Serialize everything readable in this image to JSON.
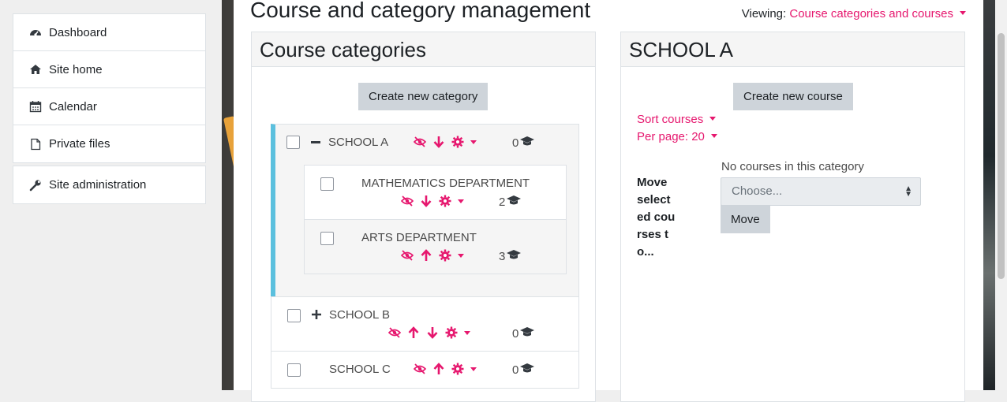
{
  "sidebar": {
    "items": [
      {
        "label": "Dashboard",
        "icon": "dashboard-icon"
      },
      {
        "label": "Site home",
        "icon": "home-icon"
      },
      {
        "label": "Calendar",
        "icon": "calendar-icon"
      },
      {
        "label": "Private files",
        "icon": "file-icon"
      }
    ],
    "admin": {
      "label": "Site administration",
      "icon": "wrench-icon"
    }
  },
  "header": {
    "title": "Course and category management",
    "viewing_label": "Viewing:",
    "viewing_value": "Course categories and courses"
  },
  "categories_panel": {
    "title": "Course categories",
    "create_button": "Create new category",
    "rows": [
      {
        "name": "SCHOOL A",
        "count": "0",
        "expanded": true
      },
      {
        "name": "MATHEMATICS DEPARTMENT",
        "count": "2"
      },
      {
        "name": "ARTS DEPARTMENT",
        "count": "3"
      },
      {
        "name": "SCHOOL B",
        "count": "0"
      },
      {
        "name": "SCHOOL C",
        "count": "0"
      }
    ]
  },
  "courses_panel": {
    "title": "SCHOOL A",
    "create_button": "Create new course",
    "sort_label": "Sort courses",
    "per_page_label": "Per page: 20",
    "move_label": "Move selected courses to...",
    "empty_text": "No courses in this category",
    "select_value": "Choose...",
    "move_button": "Move"
  },
  "colors": {
    "accent": "#e6176e",
    "active_border": "#5bc0de"
  }
}
